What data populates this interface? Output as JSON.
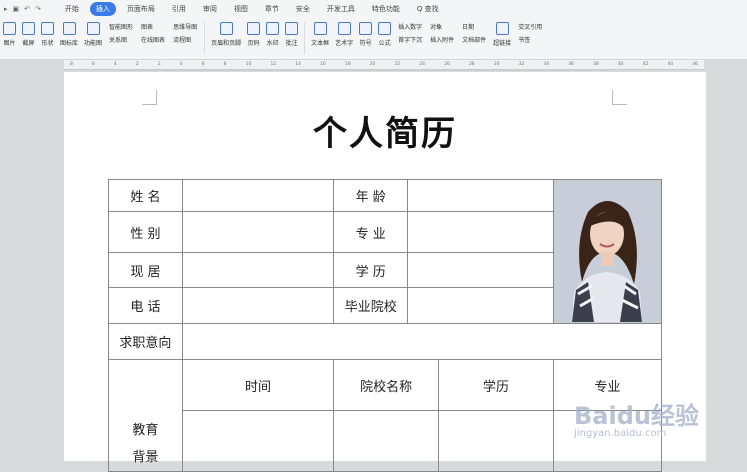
{
  "menubar": {
    "tabs": [
      {
        "label": "开始",
        "active": false
      },
      {
        "label": "插入",
        "active": true
      },
      {
        "label": "页面布局",
        "active": false
      },
      {
        "label": "引用",
        "active": false
      },
      {
        "label": "审阅",
        "active": false
      },
      {
        "label": "视图",
        "active": false
      },
      {
        "label": "章节",
        "active": false
      },
      {
        "label": "安全",
        "active": false
      },
      {
        "label": "开发工具",
        "active": false
      },
      {
        "label": "特色功能",
        "active": false
      }
    ],
    "search_label": "Q 查找",
    "accent_color": "#3b7be8"
  },
  "ribbon": {
    "buttons": [
      "图片",
      "截屏",
      "形状",
      "图标库",
      "功能图",
      "页眉和页脚",
      "页码",
      "水印",
      "批注",
      "文本框",
      "艺术字",
      "符号",
      "公式",
      "超链接",
      "书签"
    ],
    "group1": [
      "智能图形",
      "关系图"
    ],
    "group2": [
      "图表",
      "在线图表"
    ],
    "group3": [
      "思维导图",
      "流程图"
    ],
    "group4": [
      "插入数字",
      "首字下沉"
    ],
    "group5": [
      "对象",
      "插入附件"
    ],
    "group6": [
      "日期",
      "文档部件"
    ],
    "group7": [
      "交叉引用"
    ]
  },
  "ruler": {
    "ticks": [
      "8",
      "6",
      "4",
      "2",
      "2",
      "4",
      "6",
      "8",
      "10",
      "12",
      "14",
      "16",
      "18",
      "20",
      "22",
      "24",
      "26",
      "28",
      "30",
      "32",
      "34",
      "36",
      "38",
      "40",
      "42",
      "44",
      "46"
    ]
  },
  "document": {
    "title": "个人简历",
    "rows": {
      "name_label": "姓 名",
      "age_label": "年 龄",
      "gender_label": "性 别",
      "major_label": "专 业",
      "residence_label": "现 居",
      "degree_label": "学 历",
      "phone_label": "电 话",
      "school_label": "毕业院校",
      "objective_label": "求职意向"
    },
    "education": {
      "section_label_line1": "教育",
      "section_label_line2": "背景",
      "headers": [
        "时间",
        "院校名称",
        "学历",
        "专业"
      ]
    }
  },
  "watermark": {
    "text": "Baidu经验",
    "sub": "jingyan.baidu.com"
  }
}
